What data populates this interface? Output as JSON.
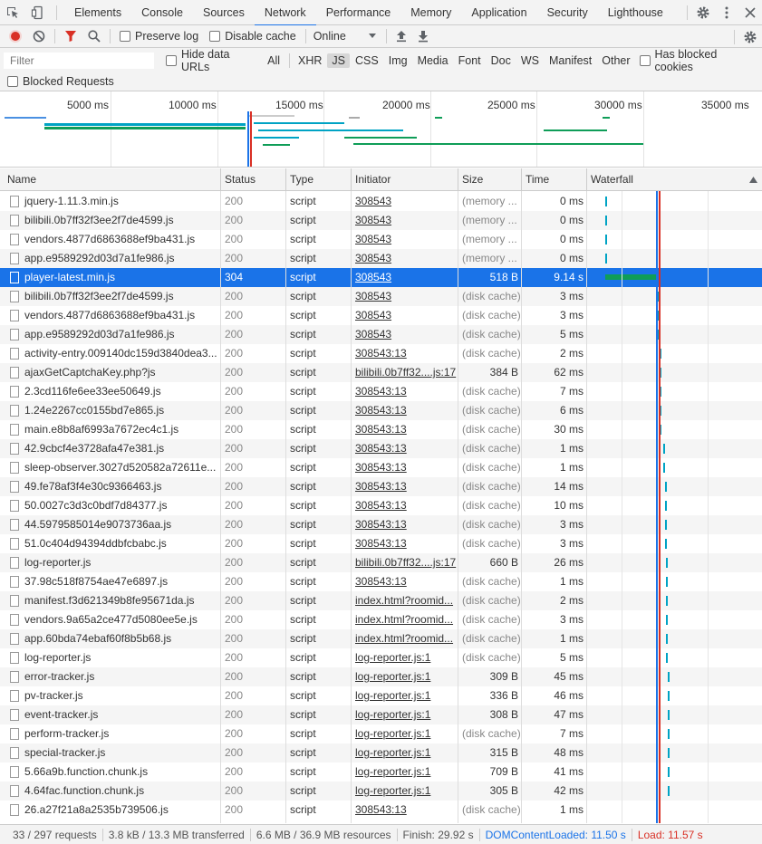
{
  "tabs": [
    "Elements",
    "Console",
    "Sources",
    "Network",
    "Performance",
    "Memory",
    "Application",
    "Security",
    "Lighthouse"
  ],
  "toolbar": {
    "preserve_log": "Preserve log",
    "disable_cache": "Disable cache",
    "throttle": "Online"
  },
  "filter": {
    "placeholder": "Filter",
    "hide_data_urls": "Hide data URLs",
    "types": [
      "All",
      "XHR",
      "JS",
      "CSS",
      "Img",
      "Media",
      "Font",
      "Doc",
      "WS",
      "Manifest",
      "Other"
    ],
    "active_type": "JS",
    "has_blocked_cookies": "Has blocked cookies",
    "blocked_requests": "Blocked Requests"
  },
  "overview": {
    "ticks": [
      "5000 ms",
      "10000 ms",
      "15000 ms",
      "20000 ms",
      "25000 ms",
      "30000 ms",
      "35000 ms"
    ]
  },
  "columns": {
    "name": "Name",
    "status": "Status",
    "type": "Type",
    "initiator": "Initiator",
    "size": "Size",
    "time": "Time",
    "waterfall": "Waterfall"
  },
  "requests": [
    {
      "name": "jquery-1.11.3.min.js",
      "status": "200",
      "type": "script",
      "initiator": "308543",
      "size": "(memory ...",
      "time": "0 ms",
      "wf": 0.02
    },
    {
      "name": "bilibili.0b7ff32f3ee2f7de4599.js",
      "status": "200",
      "type": "script",
      "initiator": "308543",
      "size": "(memory ...",
      "time": "0 ms",
      "wf": 0.02
    },
    {
      "name": "vendors.4877d6863688ef9ba431.js",
      "status": "200",
      "type": "script",
      "initiator": "308543",
      "size": "(memory ...",
      "time": "0 ms",
      "wf": 0.02
    },
    {
      "name": "app.e9589292d03d7a1fe986.js",
      "status": "200",
      "type": "script",
      "initiator": "308543",
      "size": "(memory ...",
      "time": "0 ms",
      "wf": 0.02
    },
    {
      "name": "player-latest.min.js",
      "status": "304",
      "type": "script",
      "initiator": "308543",
      "size": "518 B",
      "time": "9.14 s",
      "wf": 0.02
    },
    {
      "name": "bilibili.0b7ff32f3ee2f7de4599.js",
      "status": "200",
      "type": "script",
      "initiator": "308543",
      "size": "(disk cache)",
      "time": "3 ms",
      "wf": 0.33
    },
    {
      "name": "vendors.4877d6863688ef9ba431.js",
      "status": "200",
      "type": "script",
      "initiator": "308543",
      "size": "(disk cache)",
      "time": "3 ms",
      "wf": 0.33
    },
    {
      "name": "app.e9589292d03d7a1fe986.js",
      "status": "200",
      "type": "script",
      "initiator": "308543",
      "size": "(disk cache)",
      "time": "5 ms",
      "wf": 0.33
    },
    {
      "name": "activity-entry.009140dc159d3840dea3...",
      "status": "200",
      "type": "script",
      "initiator": "308543:13",
      "size": "(disk cache)",
      "time": "2 ms",
      "wf": 0.34
    },
    {
      "name": "ajaxGetCaptchaKey.php?js",
      "status": "200",
      "type": "script",
      "initiator": "bilibili.0b7ff32....js:17",
      "size": "384 B",
      "time": "62 ms",
      "wf": 0.34
    },
    {
      "name": "2.3cd116fe6ee33ee50649.js",
      "status": "200",
      "type": "script",
      "initiator": "308543:13",
      "size": "(disk cache)",
      "time": "7 ms",
      "wf": 0.34
    },
    {
      "name": "1.24e2267cc0155bd7e865.js",
      "status": "200",
      "type": "script",
      "initiator": "308543:13",
      "size": "(disk cache)",
      "time": "6 ms",
      "wf": 0.34
    },
    {
      "name": "main.e8b8af6993a7672ec4c1.js",
      "status": "200",
      "type": "script",
      "initiator": "308543:13",
      "size": "(disk cache)",
      "time": "30 ms",
      "wf": 0.34
    },
    {
      "name": "42.9cbcf4e3728afa47e381.js",
      "status": "200",
      "type": "script",
      "initiator": "308543:13",
      "size": "(disk cache)",
      "time": "1 ms",
      "wf": 0.36
    },
    {
      "name": "sleep-observer.3027d520582a72611e...",
      "status": "200",
      "type": "script",
      "initiator": "308543:13",
      "size": "(disk cache)",
      "time": "1 ms",
      "wf": 0.36
    },
    {
      "name": "49.fe78af3f4e30c9366463.js",
      "status": "200",
      "type": "script",
      "initiator": "308543:13",
      "size": "(disk cache)",
      "time": "14 ms",
      "wf": 0.37
    },
    {
      "name": "50.0027c3d3c0bdf7d84377.js",
      "status": "200",
      "type": "script",
      "initiator": "308543:13",
      "size": "(disk cache)",
      "time": "10 ms",
      "wf": 0.37
    },
    {
      "name": "44.5979585014e9073736aa.js",
      "status": "200",
      "type": "script",
      "initiator": "308543:13",
      "size": "(disk cache)",
      "time": "3 ms",
      "wf": 0.37
    },
    {
      "name": "51.0c404d94394ddbfcbabc.js",
      "status": "200",
      "type": "script",
      "initiator": "308543:13",
      "size": "(disk cache)",
      "time": "3 ms",
      "wf": 0.37
    },
    {
      "name": "log-reporter.js",
      "status": "200",
      "type": "script",
      "initiator": "bilibili.0b7ff32....js:17",
      "size": "660 B",
      "time": "26 ms",
      "wf": 0.38
    },
    {
      "name": "37.98c518f8754ae47e6897.js",
      "status": "200",
      "type": "script",
      "initiator": "308543:13",
      "size": "(disk cache)",
      "time": "1 ms",
      "wf": 0.38
    },
    {
      "name": "manifest.f3d621349b8fe95671da.js",
      "status": "200",
      "type": "script",
      "initiator": "index.html?roomid...",
      "size": "(disk cache)",
      "time": "2 ms",
      "wf": 0.38
    },
    {
      "name": "vendors.9a65a2ce477d5080ee5e.js",
      "status": "200",
      "type": "script",
      "initiator": "index.html?roomid...",
      "size": "(disk cache)",
      "time": "3 ms",
      "wf": 0.38
    },
    {
      "name": "app.60bda74ebaf60f8b5b68.js",
      "status": "200",
      "type": "script",
      "initiator": "index.html?roomid...",
      "size": "(disk cache)",
      "time": "1 ms",
      "wf": 0.38
    },
    {
      "name": "log-reporter.js",
      "status": "200",
      "type": "script",
      "initiator": "log-reporter.js:1",
      "size": "(disk cache)",
      "time": "5 ms",
      "wf": 0.38
    },
    {
      "name": "error-tracker.js",
      "status": "200",
      "type": "script",
      "initiator": "log-reporter.js:1",
      "size": "309 B",
      "time": "45 ms",
      "wf": 0.39
    },
    {
      "name": "pv-tracker.js",
      "status": "200",
      "type": "script",
      "initiator": "log-reporter.js:1",
      "size": "336 B",
      "time": "46 ms",
      "wf": 0.39
    },
    {
      "name": "event-tracker.js",
      "status": "200",
      "type": "script",
      "initiator": "log-reporter.js:1",
      "size": "308 B",
      "time": "47 ms",
      "wf": 0.39
    },
    {
      "name": "perform-tracker.js",
      "status": "200",
      "type": "script",
      "initiator": "log-reporter.js:1",
      "size": "(disk cache)",
      "time": "7 ms",
      "wf": 0.39
    },
    {
      "name": "special-tracker.js",
      "status": "200",
      "type": "script",
      "initiator": "log-reporter.js:1",
      "size": "315 B",
      "time": "48 ms",
      "wf": 0.39
    },
    {
      "name": "5.66a9b.function.chunk.js",
      "status": "200",
      "type": "script",
      "initiator": "log-reporter.js:1",
      "size": "709 B",
      "time": "41 ms",
      "wf": 0.39
    },
    {
      "name": "4.64fac.function.chunk.js",
      "status": "200",
      "type": "script",
      "initiator": "log-reporter.js:1",
      "size": "305 B",
      "time": "42 ms",
      "wf": 0.39
    },
    {
      "name": "26.a27f21a8a2535b739506.js",
      "status": "200",
      "type": "script",
      "initiator": "308543:13",
      "size": "(disk cache)",
      "time": "1 ms",
      "wf": 0.98
    }
  ],
  "selected_index": 4,
  "statusbar": {
    "requests": "33 / 297 requests",
    "transferred": "3.8 kB / 13.3 MB transferred",
    "resources": "6.6 MB / 36.9 MB resources",
    "finish": "Finish: 29.92 s",
    "dom_content_loaded": "DOMContentLoaded: 11.50 s",
    "load": "Load: 11.57 s"
  },
  "colors": {
    "accent": "#1a73e8",
    "record": "#d93025",
    "dcl": "#1a73e8",
    "load": "#d93025",
    "waterfall_bar": "#00a3c4",
    "waterfall_bar_long": "#0f9d58"
  }
}
